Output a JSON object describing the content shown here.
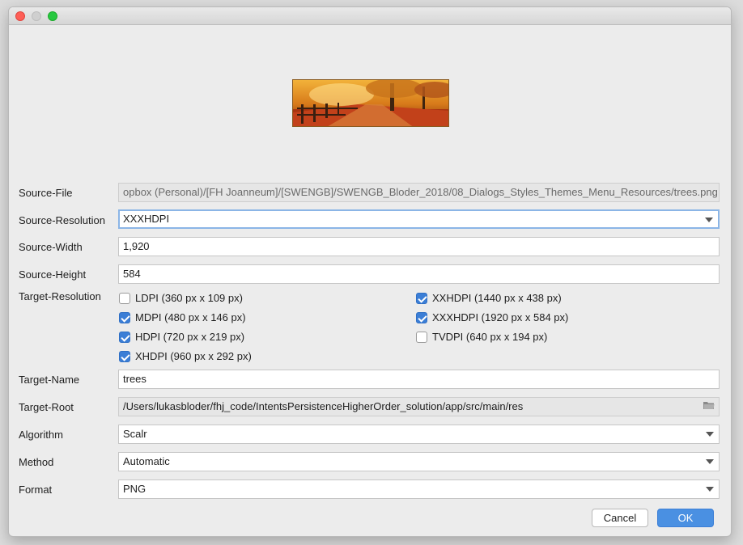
{
  "window": {
    "controls": [
      "close",
      "minimize",
      "maximize"
    ]
  },
  "preview": {
    "alt": "trees"
  },
  "labels": {
    "source_file": "Source-File",
    "source_resolution": "Source-Resolution",
    "source_width": "Source-Width",
    "source_height": "Source-Height",
    "target_resolution": "Target-Resolution",
    "target_name": "Target-Name",
    "target_root": "Target-Root",
    "algorithm": "Algorithm",
    "method": "Method",
    "format": "Format"
  },
  "values": {
    "source_file": "opbox (Personal)/[FH Joanneum]/[SWENGB]/SWENGB_Bloder_2018/08_Dialogs_Styles_Themes_Menu_Resources/trees.png",
    "source_resolution": "XXXHDPI",
    "source_width": "1,920",
    "source_height": "584",
    "target_name": "trees",
    "target_root": "/Users/lukasbloder/fhj_code/IntentsPersistenceHigherOrder_solution/app/src/main/res",
    "algorithm": "Scalr",
    "method": "Automatic",
    "format": "PNG"
  },
  "targets": [
    {
      "label": "LDPI (360 px x 109 px)",
      "checked": false
    },
    {
      "label": "MDPI (480 px x 146 px)",
      "checked": true
    },
    {
      "label": "HDPI (720 px x 219 px)",
      "checked": true
    },
    {
      "label": "XHDPI (960 px x 292 px)",
      "checked": true
    },
    {
      "label": "XXHDPI (1440 px x 438 px)",
      "checked": true
    },
    {
      "label": "XXXHDPI (1920 px x 584 px)",
      "checked": true
    },
    {
      "label": "TVDPI (640 px x 194 px)",
      "checked": false
    }
  ],
  "buttons": {
    "cancel": "Cancel",
    "ok": "OK"
  },
  "icons": {
    "dropdown": "chevron-down-icon",
    "browse": "folder-icon"
  },
  "colors": {
    "accent": "#4a90e2",
    "focus_ring": "#8bb5e6"
  }
}
